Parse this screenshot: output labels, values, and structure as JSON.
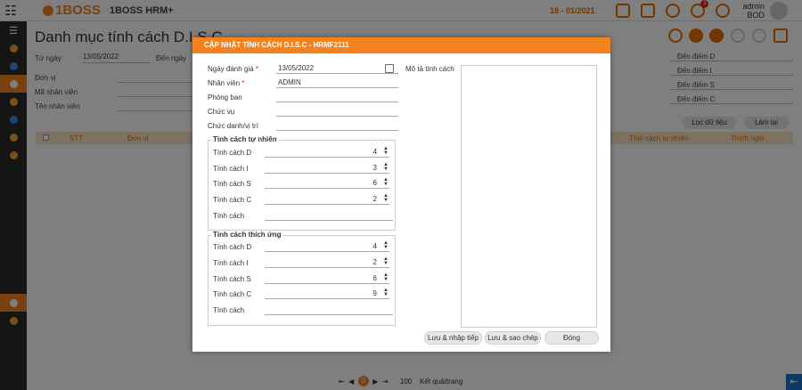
{
  "header": {
    "logo": "1BOSS",
    "app_name": "1BOSS HRM+",
    "period": "18 - 01/2021",
    "notification_count": "2",
    "user_name": "admin",
    "user_role": "BOD"
  },
  "page": {
    "title": "Danh mục tính cách D.I.S.C",
    "filters": {
      "tu_ngay_label": "Từ ngày",
      "tu_ngay_value": "13/05/2022",
      "den_ngay_label": "Đến ngày",
      "don_vi_label": "Đơn vị",
      "ma_nv_label": "Mã nhân viên",
      "ten_nv_label": "Tên nhân viên",
      "den_diem_d": "Đến điểm D",
      "den_diem_i": "Đến điểm I",
      "den_diem_s": "Đến điểm S",
      "den_diem_c": "Đến điểm C"
    },
    "loc_du_lieu": "Lọc dữ liệu",
    "lam_lai": "Làm lại",
    "columns": [
      "STT",
      "Đơn vị",
      "Tính cách tự nhiên",
      "Thích nghi"
    ],
    "pager": {
      "current": "0",
      "page_size": "100",
      "label": "Kết quả/trang"
    }
  },
  "modal": {
    "title": "CẬP NHẬT TÍNH CÁCH D.I.S.C - HRMF2111",
    "ngay_danh_gia_label": "Ngày đánh giá",
    "ngay_danh_gia_value": "13/05/2022",
    "nhan_vien_label": "Nhân viên",
    "nhan_vien_value": "ADMIN",
    "phong_ban_label": "Phòng ban",
    "chuc_vu_label": "Chức vụ",
    "chuc_danh_label": "Chức danh/vị trí",
    "mo_ta_label": "Mô tả tính cách",
    "tu_nhien": {
      "title": "Tính cách tự nhiên",
      "d_label": "Tính cách D",
      "d": "4",
      "i_label": "Tính cách I",
      "i": "3",
      "s_label": "Tính cách S",
      "s": "6",
      "c_label": "Tính cách C",
      "c": "2",
      "tc_label": "Tính cách"
    },
    "thich_ung": {
      "title": "Tính cách thích ứng",
      "d_label": "Tính cách D",
      "d": "4",
      "i_label": "Tính cách I",
      "i": "2",
      "s_label": "Tính cách S",
      "s": "6",
      "c_label": "Tính cách C",
      "c": "9",
      "tc_label": "Tính cách"
    },
    "buttons": {
      "save_next": "Lưu & nhập tiếp",
      "save_copy": "Lưu & sao chép",
      "close": "Đóng"
    }
  }
}
